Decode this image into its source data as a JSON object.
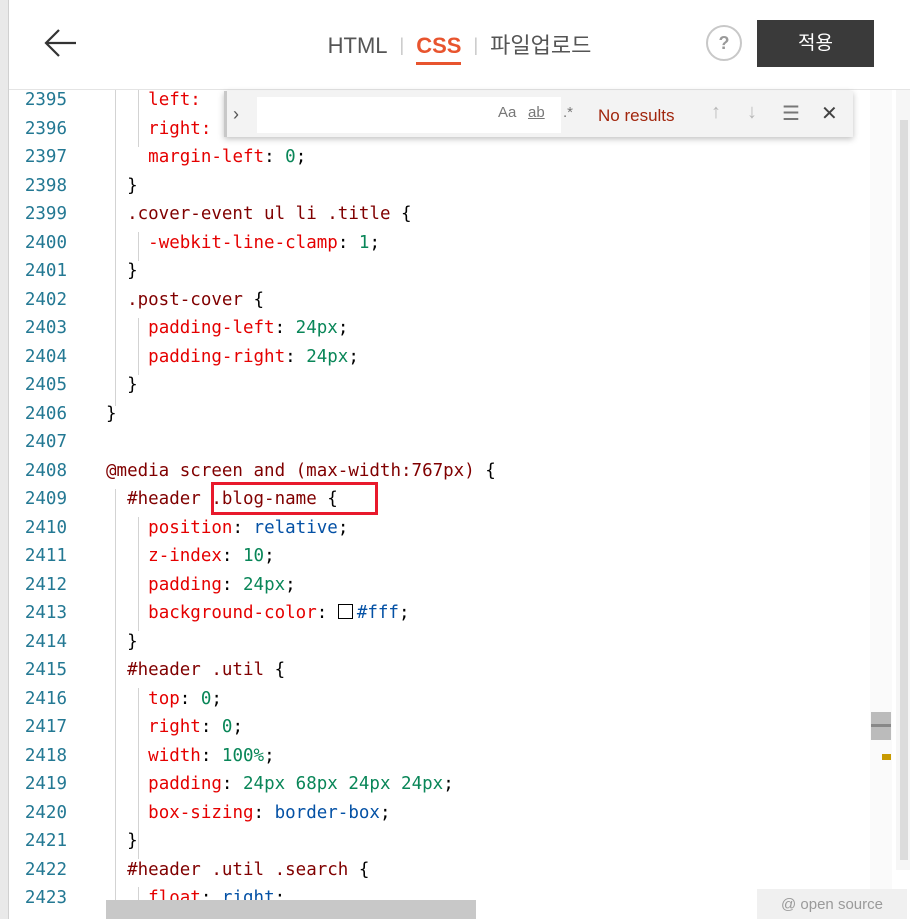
{
  "header": {
    "tabs": [
      {
        "label": "HTML",
        "active": false
      },
      {
        "label": "CSS",
        "active": true
      },
      {
        "label": "파일업로드",
        "active": false
      }
    ],
    "help_label": "?",
    "apply_label": "적용"
  },
  "find_widget": {
    "search_value": "",
    "match_case_label": "Aa",
    "whole_word_label": "ab",
    "regex_label": ".*",
    "status": "No results"
  },
  "editor": {
    "lines": [
      {
        "num": "2395",
        "tokens": [
          {
            "t": "    "
          },
          {
            "c": "prop",
            "t": "left:"
          }
        ]
      },
      {
        "num": "2396",
        "tokens": [
          {
            "t": "    "
          },
          {
            "c": "prop",
            "t": "right:"
          }
        ]
      },
      {
        "num": "2397",
        "tokens": [
          {
            "t": "    "
          },
          {
            "c": "prop",
            "t": "margin-left"
          },
          {
            "c": "punc",
            "t": ": "
          },
          {
            "c": "num",
            "t": "0"
          },
          {
            "c": "punc",
            "t": ";"
          }
        ]
      },
      {
        "num": "2398",
        "tokens": [
          {
            "t": "  "
          },
          {
            "c": "punc",
            "t": "}"
          }
        ]
      },
      {
        "num": "2399",
        "tokens": [
          {
            "t": "  "
          },
          {
            "c": "sel",
            "t": ".cover-event ul li .title"
          },
          {
            "c": "punc",
            "t": " {"
          }
        ]
      },
      {
        "num": "2400",
        "tokens": [
          {
            "t": "    "
          },
          {
            "c": "prop",
            "t": "-webkit-line-clamp"
          },
          {
            "c": "punc",
            "t": ": "
          },
          {
            "c": "num",
            "t": "1"
          },
          {
            "c": "punc",
            "t": ";"
          }
        ]
      },
      {
        "num": "2401",
        "tokens": [
          {
            "t": "  "
          },
          {
            "c": "punc",
            "t": "}"
          }
        ]
      },
      {
        "num": "2402",
        "tokens": [
          {
            "t": "  "
          },
          {
            "c": "sel",
            "t": ".post-cover"
          },
          {
            "c": "punc",
            "t": " {"
          }
        ]
      },
      {
        "num": "2403",
        "tokens": [
          {
            "t": "    "
          },
          {
            "c": "prop",
            "t": "padding-left"
          },
          {
            "c": "punc",
            "t": ": "
          },
          {
            "c": "num",
            "t": "24px"
          },
          {
            "c": "punc",
            "t": ";"
          }
        ]
      },
      {
        "num": "2404",
        "tokens": [
          {
            "t": "    "
          },
          {
            "c": "prop",
            "t": "padding-right"
          },
          {
            "c": "punc",
            "t": ": "
          },
          {
            "c": "num",
            "t": "24px"
          },
          {
            "c": "punc",
            "t": ";"
          }
        ]
      },
      {
        "num": "2405",
        "tokens": [
          {
            "t": "  "
          },
          {
            "c": "punc",
            "t": "}"
          }
        ]
      },
      {
        "num": "2406",
        "tokens": [
          {
            "c": "punc",
            "t": "}"
          }
        ]
      },
      {
        "num": "2407",
        "tokens": []
      },
      {
        "num": "2408",
        "tokens": [
          {
            "c": "sel",
            "t": "@media screen and (max-width:767px)"
          },
          {
            "c": "punc",
            "t": " {"
          }
        ]
      },
      {
        "num": "2409",
        "tokens": [
          {
            "t": "  "
          },
          {
            "c": "sel",
            "t": "#header .blog-name"
          },
          {
            "c": "punc",
            "t": " {"
          }
        ]
      },
      {
        "num": "2410",
        "tokens": [
          {
            "t": "    "
          },
          {
            "c": "prop",
            "t": "position"
          },
          {
            "c": "punc",
            "t": ": "
          },
          {
            "c": "val",
            "t": "relative"
          },
          {
            "c": "punc",
            "t": ";"
          }
        ]
      },
      {
        "num": "2411",
        "tokens": [
          {
            "t": "    "
          },
          {
            "c": "prop",
            "t": "z-index"
          },
          {
            "c": "punc",
            "t": ": "
          },
          {
            "c": "num",
            "t": "10"
          },
          {
            "c": "punc",
            "t": ";"
          }
        ]
      },
      {
        "num": "2412",
        "tokens": [
          {
            "t": "    "
          },
          {
            "c": "prop",
            "t": "padding"
          },
          {
            "c": "punc",
            "t": ": "
          },
          {
            "c": "num",
            "t": "24px"
          },
          {
            "c": "punc",
            "t": ";"
          }
        ]
      },
      {
        "num": "2413",
        "tokens": [
          {
            "t": "    "
          },
          {
            "c": "prop",
            "t": "background-color"
          },
          {
            "c": "punc",
            "t": ": "
          },
          {
            "c": "swatch",
            "t": ""
          },
          {
            "c": "val",
            "t": "#fff"
          },
          {
            "c": "punc",
            "t": ";"
          }
        ]
      },
      {
        "num": "2414",
        "tokens": [
          {
            "t": "  "
          },
          {
            "c": "punc",
            "t": "}"
          }
        ]
      },
      {
        "num": "2415",
        "tokens": [
          {
            "t": "  "
          },
          {
            "c": "sel",
            "t": "#header .util"
          },
          {
            "c": "punc",
            "t": " {"
          }
        ]
      },
      {
        "num": "2416",
        "tokens": [
          {
            "t": "    "
          },
          {
            "c": "prop",
            "t": "top"
          },
          {
            "c": "punc",
            "t": ": "
          },
          {
            "c": "num",
            "t": "0"
          },
          {
            "c": "punc",
            "t": ";"
          }
        ]
      },
      {
        "num": "2417",
        "tokens": [
          {
            "t": "    "
          },
          {
            "c": "prop",
            "t": "right"
          },
          {
            "c": "punc",
            "t": ": "
          },
          {
            "c": "num",
            "t": "0"
          },
          {
            "c": "punc",
            "t": ";"
          }
        ]
      },
      {
        "num": "2418",
        "tokens": [
          {
            "t": "    "
          },
          {
            "c": "prop",
            "t": "width"
          },
          {
            "c": "punc",
            "t": ": "
          },
          {
            "c": "num",
            "t": "100%"
          },
          {
            "c": "punc",
            "t": ";"
          }
        ]
      },
      {
        "num": "2419",
        "tokens": [
          {
            "t": "    "
          },
          {
            "c": "prop",
            "t": "padding"
          },
          {
            "c": "punc",
            "t": ": "
          },
          {
            "c": "num",
            "t": "24px 68px 24px 24px"
          },
          {
            "c": "punc",
            "t": ";"
          }
        ]
      },
      {
        "num": "2420",
        "tokens": [
          {
            "t": "    "
          },
          {
            "c": "prop",
            "t": "box-sizing"
          },
          {
            "c": "punc",
            "t": ": "
          },
          {
            "c": "val",
            "t": "border-box"
          },
          {
            "c": "punc",
            "t": ";"
          }
        ]
      },
      {
        "num": "2421",
        "tokens": [
          {
            "t": "  "
          },
          {
            "c": "punc",
            "t": "}"
          }
        ]
      },
      {
        "num": "2422",
        "tokens": [
          {
            "t": "  "
          },
          {
            "c": "sel",
            "t": "#header .util .search"
          },
          {
            "c": "punc",
            "t": " {"
          }
        ]
      },
      {
        "num": "2423",
        "tokens": [
          {
            "t": "    "
          },
          {
            "c": "prop",
            "t": "float"
          },
          {
            "c": "punc",
            "t": ": "
          },
          {
            "c": "val",
            "t": "right"
          },
          {
            "c": "punc",
            "t": ";"
          }
        ]
      }
    ]
  },
  "footer": {
    "badge": "@ open source"
  },
  "colors": {
    "accent": "#e8542e",
    "highlight_box": "#e8192c",
    "line_number": "#237893",
    "selector": "#800000",
    "property": "#e50000",
    "number": "#098658",
    "value": "#0451a5"
  }
}
